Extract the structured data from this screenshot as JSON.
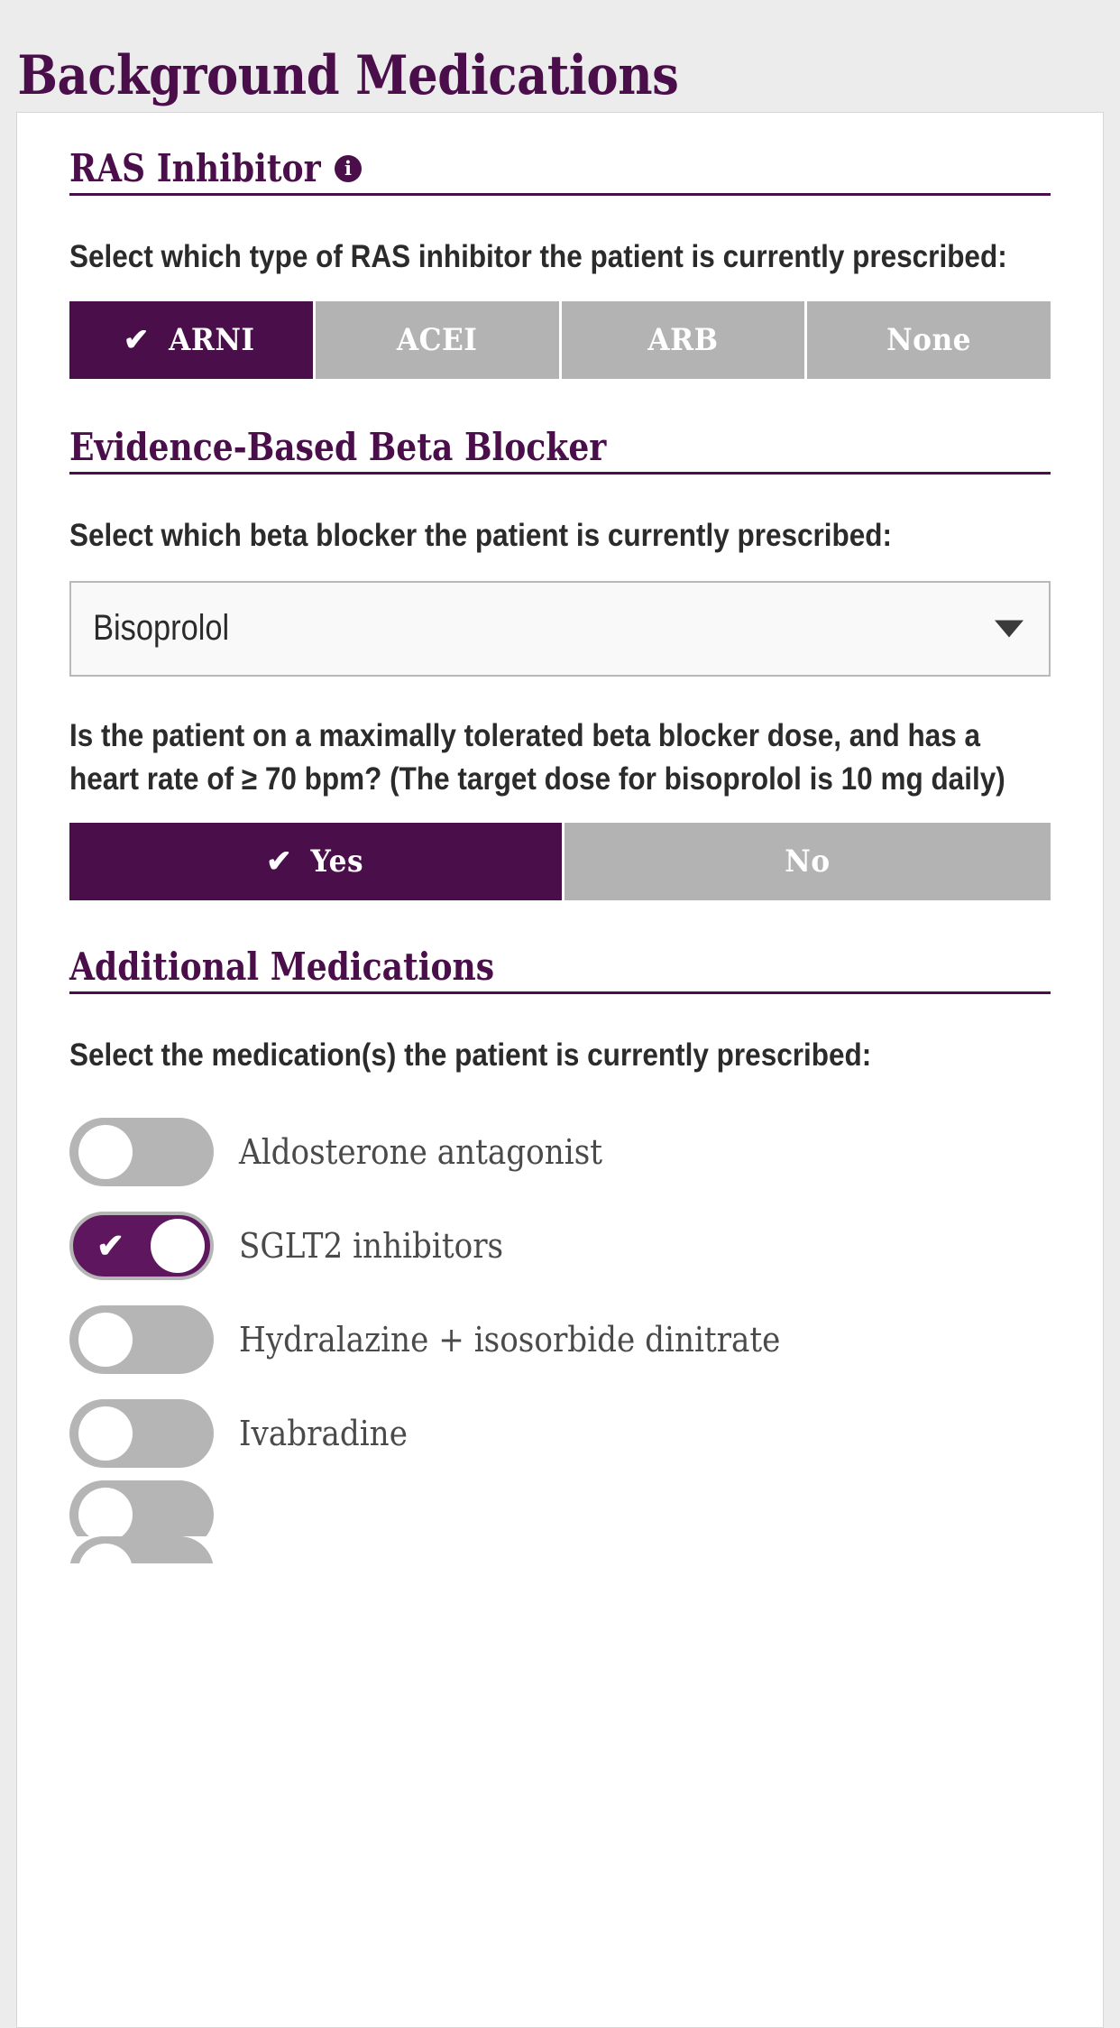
{
  "page": {
    "title": "Background Medications",
    "accent_color": "#4a0e4a",
    "inactive_color": "#b3b3b3",
    "background_color": "#ececec"
  },
  "sections": {
    "ras": {
      "heading": "RAS Inhibitor",
      "info_icon": "info-icon",
      "info_glyph": "i",
      "prompt": "Select which type of RAS inhibitor the patient is currently prescribed:",
      "options": [
        {
          "label": "ARNI",
          "selected": true
        },
        {
          "label": "ACEI",
          "selected": false
        },
        {
          "label": "ARB",
          "selected": false
        },
        {
          "label": "None",
          "selected": false
        }
      ],
      "check_glyph": "✔"
    },
    "beta_blocker": {
      "heading": "Evidence-Based Beta Blocker",
      "prompt": "Select which beta blocker the patient is currently prescribed:",
      "select": {
        "value": "Bisoprolol",
        "arrow_icon": "chevron-down-icon"
      },
      "dose_question": "Is the patient on a maximally tolerated beta blocker dose, and has a heart rate of ≥ 70 bpm? (The target dose for bisoprolol is 10 mg daily)",
      "options": [
        {
          "label": "Yes",
          "selected": true
        },
        {
          "label": "No",
          "selected": false
        }
      ],
      "check_glyph": "✔"
    },
    "additional": {
      "heading": "Additional Medications",
      "prompt": "Select the medication(s) the patient is currently prescribed:",
      "check_glyph": "✔",
      "toggles": [
        {
          "label": "Aldosterone antagonist",
          "on": false
        },
        {
          "label": "SGLT2 inhibitors",
          "on": true
        },
        {
          "label": "Hydralazine + isosorbide dinitrate",
          "on": false
        },
        {
          "label": "Ivabradine",
          "on": false
        },
        {
          "label": "",
          "on": false
        },
        {
          "label": "",
          "on": false
        }
      ]
    }
  }
}
